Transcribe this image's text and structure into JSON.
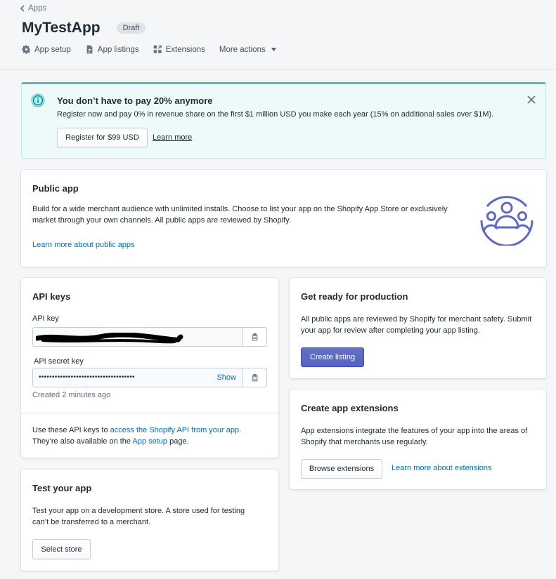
{
  "breadcrumb": {
    "label": "Apps"
  },
  "app": {
    "title": "MyTestApp",
    "status_badge": "Draft"
  },
  "tabs": [
    {
      "label": "App setup",
      "icon": "gear-icon"
    },
    {
      "label": "App listings",
      "icon": "document-icon"
    },
    {
      "label": "Extensions",
      "icon": "extensions-icon"
    },
    {
      "label": "More actions",
      "icon": "caret-down-icon"
    }
  ],
  "banner": {
    "title": "You don’t have to pay 20% anymore",
    "text": "Register now and pay 0% in revenue share on the first $1 million USD you make each year (15% on additional sales over $1M).",
    "button": "Register for $99 USD",
    "link": "Learn more",
    "colors": {
      "background": "#eef9f9",
      "accent": "#47c1bf"
    }
  },
  "public_app": {
    "title": "Public app",
    "line1": "Build for a wide merchant audience with unlimited installs. Choose to list your app on the Shopify App Store or exclusively",
    "line2": "market through your own channels. All public apps are reviewed by Shopify.",
    "link": "Learn more about public apps",
    "illustration": "people-group-icon"
  },
  "api_keys": {
    "title": "API keys",
    "api_key_label": "API key",
    "api_key_value": "[redacted]",
    "secret_label": "API secret key",
    "secret_value": "••••••••••••••••••••••••••••••••••••",
    "show_label": "Show",
    "created": "Created 2 minutes ago",
    "footer_prefix": "Use these API keys to ",
    "footer_link1": "access the Shopify API from your app",
    "footer_mid": ".",
    "footer_line2_prefix": "They’re also available on the ",
    "footer_link2": "App setup",
    "footer_suffix": " page."
  },
  "test_app": {
    "title": "Test your app",
    "line1": "Test your app on a development store. A store used for testing",
    "line2": "can’t be transferred to a merchant.",
    "button": "Select store"
  },
  "production": {
    "title": "Get ready for production",
    "line1": "All public apps are reviewed by Shopify for merchant safety. Submit",
    "line2": "your app for review after completing your app listing.",
    "button": "Create listing",
    "colors": {
      "primary": "#5c6ac4"
    }
  },
  "extensions": {
    "title": "Create app extensions",
    "line1": "App extensions integrate the features of your app into the areas of",
    "line2": "Shopify that merchants use regularly.",
    "button": "Browse extensions",
    "link": "Learn more about extensions"
  }
}
